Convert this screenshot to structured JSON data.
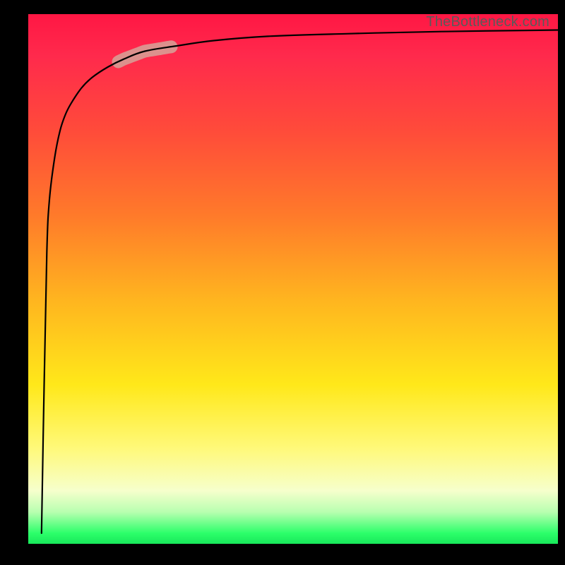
{
  "watermark": "TheBottleneck.com",
  "chart_data": {
    "type": "line",
    "title": "",
    "xlabel": "",
    "ylabel": "",
    "xlim": [
      0,
      100
    ],
    "ylim": [
      0,
      100
    ],
    "series": [
      {
        "name": "bottleneck-curve",
        "x": [
          2.5,
          3.0,
          3.5,
          4.0,
          5.0,
          6.0,
          7.0,
          8.0,
          10,
          12,
          15,
          18,
          22,
          28,
          35,
          45,
          60,
          78,
          100
        ],
        "y": [
          2.0,
          30,
          55,
          65,
          73,
          78,
          81,
          83,
          86,
          88,
          90,
          91.5,
          93,
          94,
          95,
          95.8,
          96.3,
          96.7,
          97
        ]
      }
    ],
    "highlight_segment": {
      "series": "bottleneck-curve",
      "x_range": [
        17,
        27
      ],
      "note": "thick pale-pink stroke overlay"
    },
    "note": "Axes are unlabeled; values expressed on a 0–100 normalized scale estimated from pixel positions. Curve rises steeply from near-origin then asymptotes toward y≈97."
  }
}
